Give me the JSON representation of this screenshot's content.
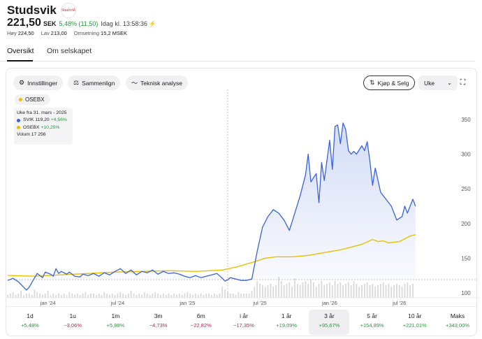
{
  "header": {
    "title": "Studsvik",
    "logo_text": "Studsvik",
    "price": "221,50",
    "currency": "SEK",
    "change": "5,48% (11,50)",
    "time": "Idag kl. 13:58:36",
    "stats": [
      {
        "label": "Høy",
        "value": "224,50"
      },
      {
        "label": "Lav",
        "value": "213,00"
      },
      {
        "label": "Omsetning",
        "value": "15,2 MSEK"
      }
    ]
  },
  "tabs": [
    {
      "label": "Oversikt",
      "active": true
    },
    {
      "label": "Om selskapet",
      "active": false
    }
  ],
  "toolbar": {
    "settings": "Innstillinger",
    "compare": "Sammenlign",
    "technical": "Teknisk analyse",
    "trade": "Kjøp & Selg",
    "interval": "Uke"
  },
  "compare_legend": "OSEBX",
  "tooltip": {
    "title": "Uke fra 31. mars - 2025",
    "svik_name": "SVIK",
    "svik_value": "119,20",
    "svik_change": "+4,56%",
    "osebx_name": "OSEBX",
    "osebx_change": "+10,25%",
    "volume_label": "Volum",
    "volume_value": "17 256"
  },
  "periods": [
    {
      "label": "1d",
      "value": "+5,48%",
      "positive": true
    },
    {
      "label": "1u",
      "value": "−3,06%",
      "positive": false
    },
    {
      "label": "1m",
      "value": "+5,98%",
      "positive": true
    },
    {
      "label": "3m",
      "value": "−4,73%",
      "positive": false
    },
    {
      "label": "6m",
      "value": "−22,82%",
      "positive": false
    },
    {
      "label": "i år",
      "value": "−17,35%",
      "positive": false
    },
    {
      "label": "1 år",
      "value": "+19,09%",
      "positive": true
    },
    {
      "label": "3 år",
      "value": "+95,67%",
      "positive": true,
      "active": true
    },
    {
      "label": "5 år",
      "value": "+154,89%",
      "positive": true
    },
    {
      "label": "10 år",
      "value": "+221,01%",
      "positive": true
    },
    {
      "label": "Maks",
      "value": "+343,00%",
      "positive": true
    }
  ],
  "colors": {
    "svik": "#3b63d9",
    "osebx": "#e8c000",
    "positive": "#1f9d37",
    "negative": "#b4235a"
  },
  "chart_data": {
    "type": "line",
    "y_ticks": [
      "350",
      "300",
      "250",
      "200",
      "150",
      "100"
    ],
    "x_ticks": [
      "jan '24",
      "jul '24",
      "jan '25",
      "jul '25",
      "jan '26",
      "jul '26"
    ],
    "ylim": [
      95,
      365
    ],
    "xlim": [
      0,
      176
    ],
    "x_tick_positions": [
      15,
      41,
      67,
      94,
      120,
      146
    ],
    "crosshair": {
      "x": 82,
      "y": 119.2
    },
    "series": [
      {
        "name": "SVIK",
        "values": [
          [
            0,
            118
          ],
          [
            2,
            121
          ],
          [
            4,
            116
          ],
          [
            5,
            112
          ],
          [
            7,
            104
          ],
          [
            8,
            108
          ],
          [
            9,
            115
          ],
          [
            11,
            128
          ],
          [
            13,
            122
          ],
          [
            14,
            130
          ],
          [
            16,
            127
          ],
          [
            17,
            124
          ],
          [
            18,
            135
          ],
          [
            19,
            128
          ],
          [
            20,
            131
          ],
          [
            22,
            127
          ],
          [
            23,
            130
          ],
          [
            25,
            124
          ],
          [
            27,
            123
          ],
          [
            28,
            127
          ],
          [
            30,
            125
          ],
          [
            32,
            128
          ],
          [
            34,
            124
          ],
          [
            36,
            129
          ],
          [
            38,
            126
          ],
          [
            40,
            131
          ],
          [
            42,
            135
          ],
          [
            44,
            128
          ],
          [
            46,
            133
          ],
          [
            48,
            126
          ],
          [
            50,
            131
          ],
          [
            52,
            129
          ],
          [
            54,
            133
          ],
          [
            56,
            127
          ],
          [
            58,
            131
          ],
          [
            60,
            128
          ],
          [
            62,
            129
          ],
          [
            64,
            127
          ],
          [
            66,
            124
          ],
          [
            68,
            122
          ],
          [
            70,
            125
          ],
          [
            72,
            122
          ],
          [
            74,
            124
          ],
          [
            76,
            126
          ],
          [
            78,
            128
          ],
          [
            80,
            121
          ],
          [
            81,
            117
          ],
          [
            82,
            119
          ],
          [
            83,
            122
          ],
          [
            85,
            120
          ],
          [
            87,
            118
          ],
          [
            89,
            118
          ],
          [
            91,
            120
          ],
          [
            93,
            160
          ],
          [
            95,
            195
          ],
          [
            97,
            210
          ],
          [
            99,
            220
          ],
          [
            101,
            215
          ],
          [
            103,
            205
          ],
          [
            105,
            190
          ],
          [
            107,
            215
          ],
          [
            109,
            240
          ],
          [
            111,
            270
          ],
          [
            112,
            300
          ],
          [
            113,
            260
          ],
          [
            115,
            272
          ],
          [
            116,
            230
          ],
          [
            117,
            288
          ],
          [
            118,
            262
          ],
          [
            120,
            320
          ],
          [
            121,
            278
          ],
          [
            122,
            340
          ],
          [
            123,
            342
          ],
          [
            124,
            315
          ],
          [
            125,
            345
          ],
          [
            126,
            335
          ],
          [
            127,
            305
          ],
          [
            128,
            300
          ],
          [
            129,
            304
          ],
          [
            130,
            300
          ],
          [
            132,
            312
          ],
          [
            133,
            305
          ],
          [
            134,
            318
          ],
          [
            135,
            290
          ],
          [
            136,
            255
          ],
          [
            137,
            280
          ],
          [
            139,
            245
          ],
          [
            141,
            235
          ],
          [
            143,
            225
          ],
          [
            145,
            205
          ],
          [
            147,
            210
          ],
          [
            148,
            225
          ],
          [
            149,
            215
          ],
          [
            151,
            235
          ],
          [
            152,
            225
          ]
        ]
      },
      {
        "name": "OSEBX",
        "values": [
          [
            0,
            125
          ],
          [
            10,
            124
          ],
          [
            20,
            126
          ],
          [
            30,
            128
          ],
          [
            40,
            130
          ],
          [
            50,
            131
          ],
          [
            60,
            132
          ],
          [
            70,
            131
          ],
          [
            80,
            133
          ],
          [
            86,
            138
          ],
          [
            92,
            145
          ],
          [
            96,
            150
          ],
          [
            100,
            152
          ],
          [
            106,
            152
          ],
          [
            112,
            154
          ],
          [
            118,
            158
          ],
          [
            124,
            162
          ],
          [
            128,
            166
          ],
          [
            132,
            170
          ],
          [
            136,
            177
          ],
          [
            138,
            174
          ],
          [
            140,
            175
          ],
          [
            142,
            172
          ],
          [
            146,
            174
          ],
          [
            150,
            182
          ],
          [
            152,
            184
          ]
        ]
      }
    ],
    "volume": [
      2,
      3,
      4,
      2,
      3,
      5,
      2,
      3,
      3,
      2,
      6,
      4,
      3,
      2,
      3,
      5,
      2,
      3,
      2,
      3,
      2,
      3,
      2,
      4,
      3,
      2,
      3,
      2,
      3,
      4,
      2,
      3,
      3,
      2,
      3,
      2,
      4,
      3,
      2,
      3,
      2,
      3,
      4,
      3,
      2,
      3,
      5,
      3,
      2,
      3,
      2,
      4,
      3,
      2,
      3,
      4,
      3,
      2,
      3,
      2,
      3,
      2,
      3,
      2,
      3,
      2,
      3,
      4,
      3,
      2,
      3,
      2,
      3,
      2,
      3,
      3,
      2,
      3,
      2,
      3,
      8,
      6,
      4,
      3,
      3,
      2,
      4,
      3,
      3,
      3,
      3,
      5,
      8,
      12,
      10,
      9,
      8,
      9,
      10,
      8,
      9,
      15,
      12,
      9,
      10,
      11,
      8,
      14,
      10,
      9,
      11,
      12,
      10,
      13,
      11,
      8,
      10,
      12,
      9,
      10,
      11,
      9,
      12,
      10,
      11,
      9,
      10,
      11,
      9,
      12,
      10,
      8,
      9,
      10,
      11,
      9,
      10,
      8,
      9,
      10,
      11,
      9,
      10,
      8,
      9,
      10,
      9,
      8,
      10,
      11,
      9,
      10
    ]
  }
}
